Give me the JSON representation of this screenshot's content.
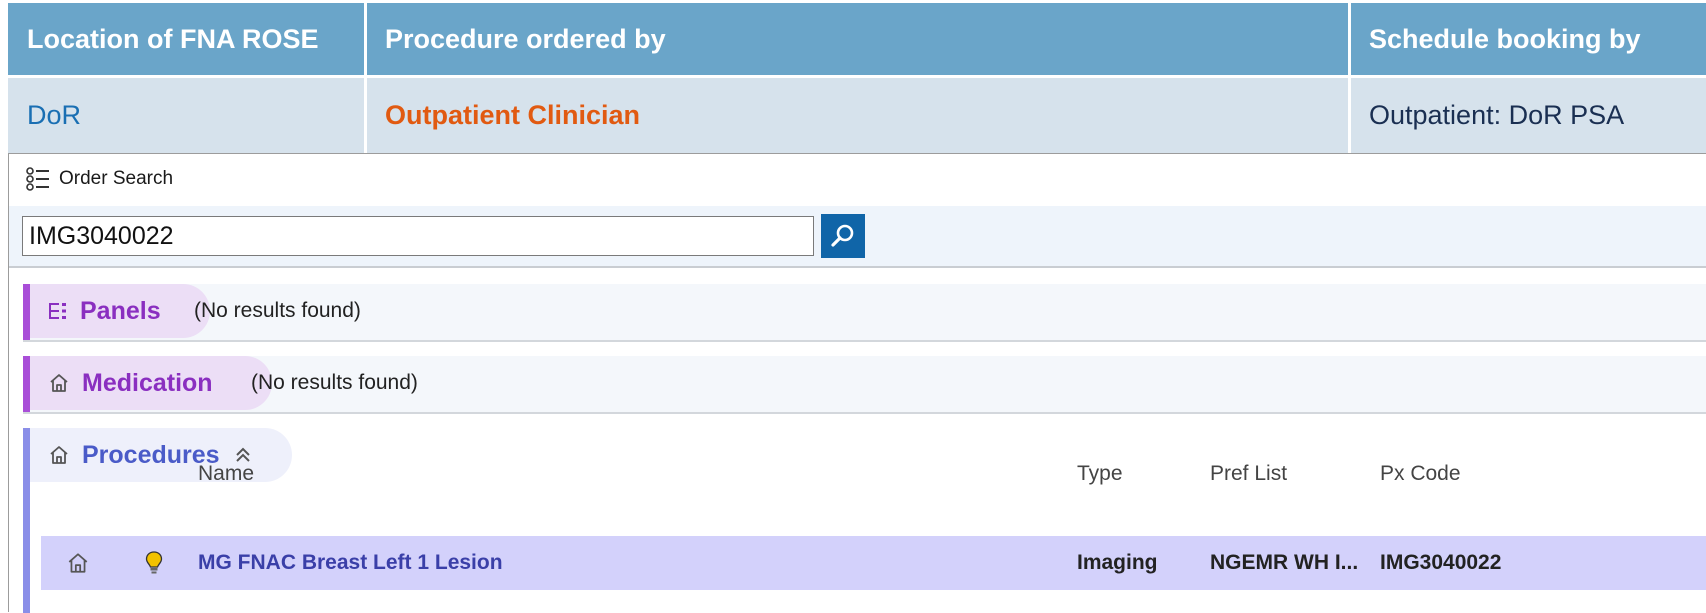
{
  "table": {
    "headers": [
      "Location of FNA ROSE",
      "Procedure ordered by",
      "Schedule booking by"
    ],
    "row": {
      "location": "DoR",
      "ordered_by": "Outpatient Clinician",
      "booking_by": "Outpatient: DoR PSA"
    }
  },
  "order_search": {
    "title": "Order Search",
    "search_value": "IMG3040022",
    "sections": {
      "panels": {
        "label": "Panels",
        "status": "(No results found)"
      },
      "medication": {
        "label": "Medication",
        "status": "(No results found)"
      },
      "procedures": {
        "label": "Procedures"
      }
    },
    "columns": {
      "name": "Name",
      "type": "Type",
      "pref_list": "Pref List",
      "px_code": "Px Code"
    },
    "results": [
      {
        "name": "MG FNAC Breast Left 1 Lesion",
        "type": "Imaging",
        "pref_list": "NGEMR WH I...",
        "px_code": "IMG3040022"
      }
    ]
  },
  "colors": {
    "header_blue": "#6aa5c9",
    "row_bg": "#d6e2ec",
    "orange": "#e15a11",
    "purple": "#a94ed8",
    "procedures_accent": "#8a8ee8",
    "selected_row": "#d3d1fb"
  }
}
